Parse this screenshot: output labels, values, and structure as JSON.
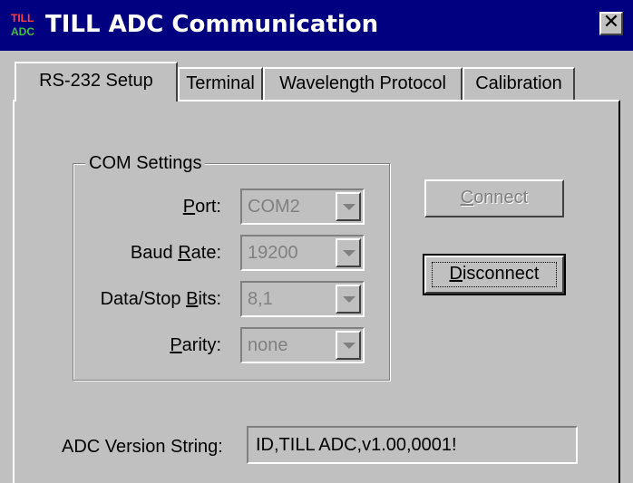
{
  "window": {
    "title": "TILL ADC Communication",
    "icon": "till-adc-app-icon",
    "close_label": "✕"
  },
  "tabs": [
    {
      "label": "RS-232 Setup",
      "active": true
    },
    {
      "label": "Terminal",
      "active": false
    },
    {
      "label": "Wavelength Protocol",
      "active": false
    },
    {
      "label": "Calibration",
      "active": false
    }
  ],
  "com_settings": {
    "title": "COM Settings",
    "port": {
      "label_pre": "",
      "label_u": "P",
      "label_post": "ort:",
      "value": "COM2"
    },
    "baud": {
      "label_pre": "Baud ",
      "label_u": "R",
      "label_post": "ate:",
      "value": "19200"
    },
    "bits": {
      "label_pre": "Data/Stop ",
      "label_u": "B",
      "label_post": "its:",
      "value": "8,1"
    },
    "parity": {
      "label_pre": "",
      "label_u": "P",
      "label_post": "arity:",
      "value": "none"
    }
  },
  "buttons": {
    "connect": {
      "label_u": "C",
      "label_post": "onnect",
      "enabled": false
    },
    "disconnect": {
      "label_u": "D",
      "label_post": "isconnect",
      "enabled": true
    }
  },
  "version": {
    "label": "ADC Version String:",
    "value": "ID,TILL ADC,v1.00,0001!"
  },
  "colors": {
    "titlebar": "#000080",
    "face": "#c0c0c0",
    "disabled_text": "#808080"
  }
}
